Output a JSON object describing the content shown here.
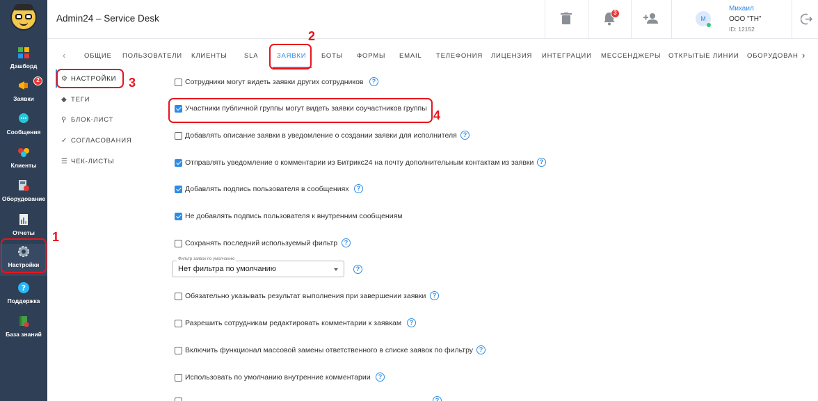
{
  "app": {
    "title": "Admin24 – Service Desk"
  },
  "user": {
    "initial": "M",
    "name": "Михаил",
    "org": "ООО \"ТН\"",
    "id": "ID: 12152"
  },
  "notifications": {
    "count": "3"
  },
  "sidebar": {
    "items": [
      {
        "label": "Дашборд",
        "icon": "dashboard-icon"
      },
      {
        "label": "Заявки",
        "icon": "megaphone-icon",
        "badge": "2"
      },
      {
        "label": "Сообщения",
        "icon": "chat-icon"
      },
      {
        "label": "Клиенты",
        "icon": "clients-icon"
      },
      {
        "label": "Оборудование",
        "icon": "equipment-icon"
      },
      {
        "label": "Отчеты",
        "icon": "reports-icon"
      },
      {
        "label": "Настройки",
        "icon": "gear-icon"
      },
      {
        "label": "Поддержка",
        "icon": "help-icon"
      },
      {
        "label": "База знаний",
        "icon": "book-icon"
      }
    ]
  },
  "tabs": [
    "ОБЩИЕ",
    "ПОЛЬЗОВАТЕЛИ",
    "КЛИЕНТЫ",
    "SLA",
    "ЗАЯВКИ",
    "БОТЫ",
    "ФОРМЫ",
    "EMAIL",
    "ТЕЛЕФОНИЯ",
    "ЛИЦЕНЗИЯ",
    "ИНТЕГРАЦИИ",
    "МЕССЕНДЖЕРЫ",
    "ОТКРЫТЫЕ ЛИНИИ",
    "ОБОРУДОВАН"
  ],
  "submenu": [
    "НАСТРОЙКИ",
    "ТЕГИ",
    "БЛОК-ЛИСТ",
    "СОГЛАСОВАНИЯ",
    "ЧЕК-ЛИСТЫ"
  ],
  "settings": [
    {
      "label": "Сотрудники могут видеть заявки других сотрудников",
      "checked": false
    },
    {
      "label": "Участники публичной группы могут видеть заявки соучастников группы",
      "checked": true
    },
    {
      "label": "Добавлять описание заявки в уведомление о создании заявки для исполнителя",
      "checked": false
    },
    {
      "label": "Отправлять уведомление о комментарии из Битрикс24 на почту дополнительным контактам из заявки",
      "checked": true
    },
    {
      "label": "Добавлять подпись пользователя в сообщениях",
      "checked": true
    },
    {
      "label": "Не добавлять подпись пользователя к внутренним сообщениям",
      "checked": true
    },
    {
      "label": "Сохранять последний используемый фильтр",
      "checked": false
    },
    {
      "label": "Обязательно указывать результат выполнения при завершении заявки",
      "checked": false
    },
    {
      "label": "Разрешить сотрудникам редактировать комментарии к заявкам",
      "checked": false
    },
    {
      "label": "Включить функционал массовой замены ответственного в списке заявок по фильтру",
      "checked": false
    },
    {
      "label": "Использовать по умолчанию внутренние комментарии",
      "checked": false
    }
  ],
  "filter_select": {
    "legend": "Фильтр заявок по умолчанию",
    "value": "Нет фильтра по умолчанию"
  },
  "annotations": [
    "1",
    "2",
    "3",
    "4"
  ],
  "help_glyph": "?",
  "colors": {
    "accent": "#2e8be6",
    "sidebar": "#2f3f55",
    "highlight": "#e8141b"
  }
}
